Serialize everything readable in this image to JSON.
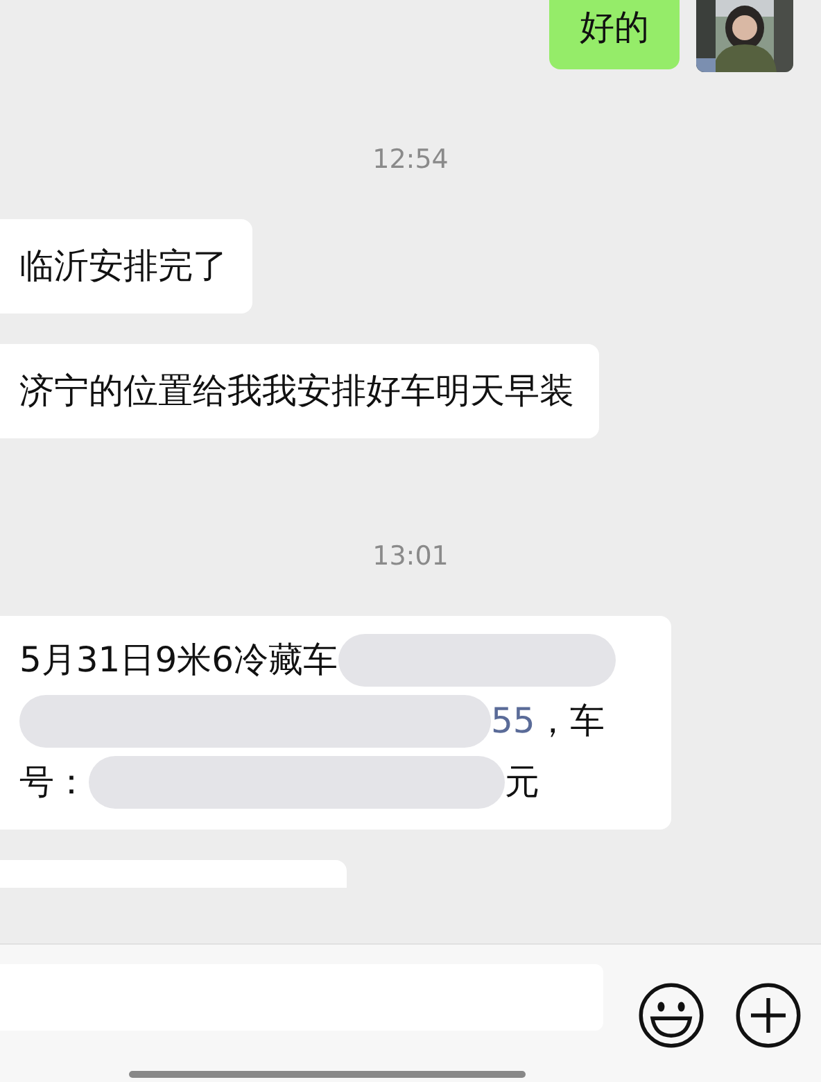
{
  "chat": [
    {
      "kind": "message",
      "from_me": true,
      "text": "好的"
    },
    {
      "kind": "time",
      "text": "12:54"
    },
    {
      "kind": "message",
      "from_me": false,
      "text": "临沂安排完了"
    },
    {
      "kind": "message",
      "from_me": false,
      "text": "济宁的位置给我我安排好车明天早装"
    },
    {
      "kind": "time",
      "text": "13:01"
    },
    {
      "kind": "redacted",
      "from_me": false,
      "lines": [
        [
          "5月31日9米6冷藏车"
        ],
        [
          "55",
          "，车"
        ],
        [
          "号：",
          "元"
        ]
      ]
    },
    {
      "kind": "partial",
      "from_me": false
    }
  ],
  "input_bar": {
    "buttons": [
      {
        "kind": "emoji"
      },
      {
        "kind": "plus"
      }
    ]
  }
}
